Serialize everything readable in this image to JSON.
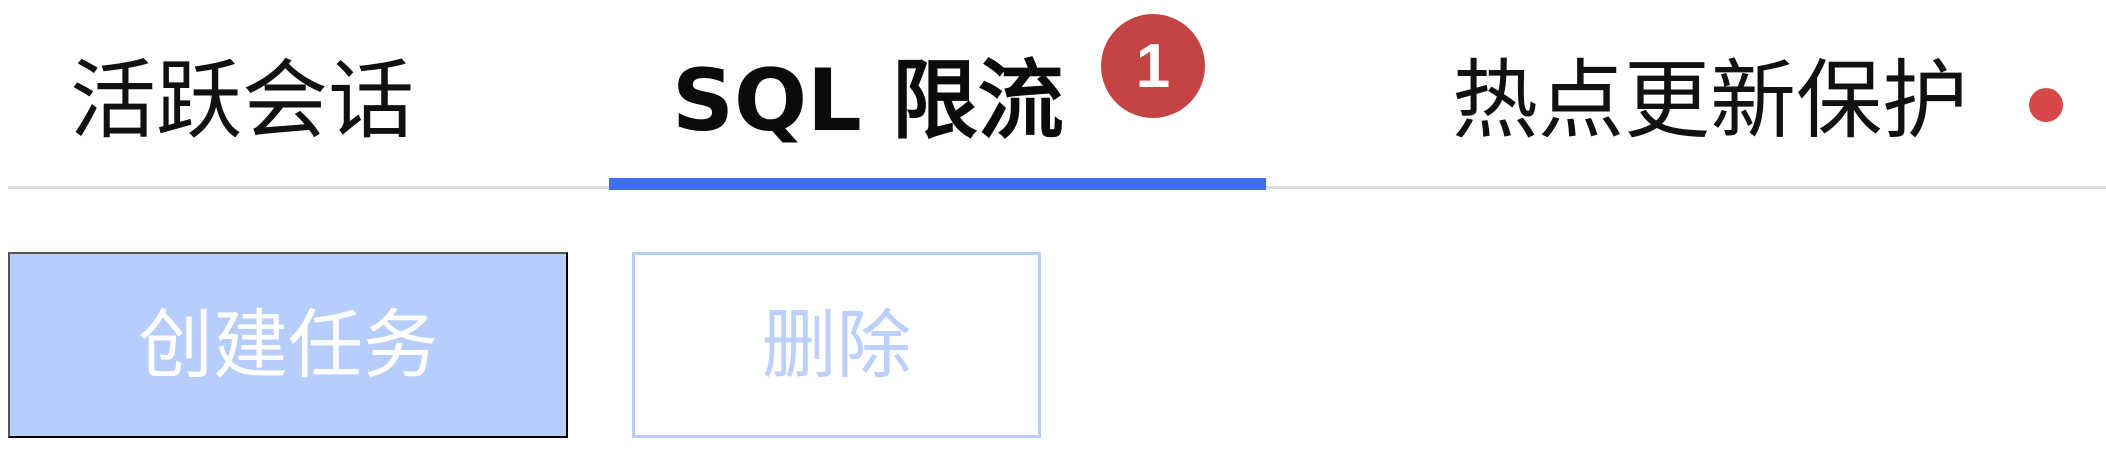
{
  "tabs": [
    {
      "label": "活跃会话",
      "active": false
    },
    {
      "label": "SQL 限流",
      "active": true,
      "badge_count": "1"
    },
    {
      "label": "热点更新保护",
      "active": false
    }
  ],
  "toolbar": {
    "create_label": "创建任务",
    "delete_label": "删除"
  },
  "colors": {
    "active_tab_underline": "#3f6ff3",
    "badge": "#c44444",
    "dot_badge": "#d84848",
    "primary_button_disabled": "#b7cdfb",
    "secondary_button_disabled_text": "#bdd0fc",
    "tab_text": "#111111",
    "divider": "#dcdcdc"
  }
}
